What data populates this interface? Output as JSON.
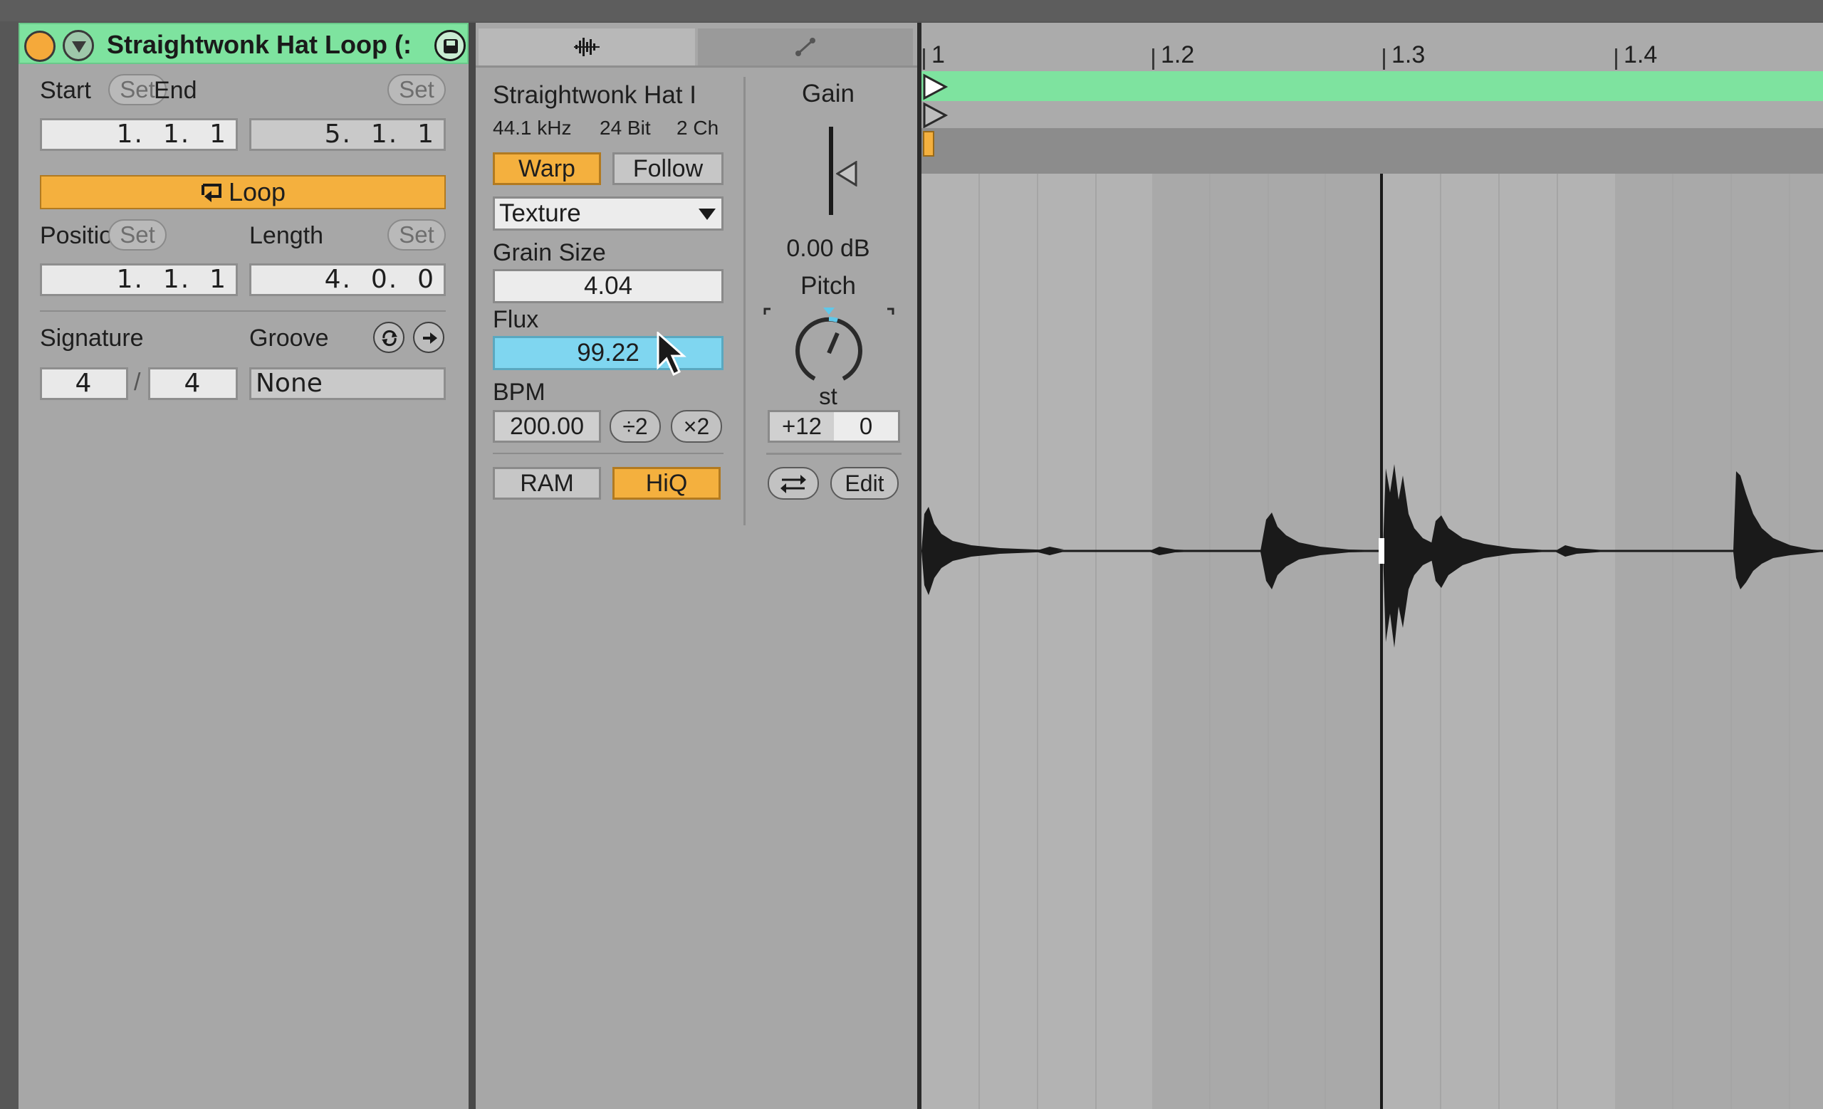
{
  "clip": {
    "name": "Straightwonk Hat Loop (:",
    "start_label": "Start",
    "end_label": "End",
    "set_label": "Set",
    "start_value": "1.  1.  1",
    "end_value": "5.  1.  1",
    "loop_label": "Loop",
    "position_label": "Position",
    "length_label": "Length",
    "position_value": "1.  1.  1",
    "length_value": "4.  0.  0",
    "signature_label": "Signature",
    "groove_label": "Groove",
    "sig_num": "4",
    "sig_slash": "/",
    "sig_den": "4",
    "groove_value": "None",
    "header_color": "#7ee39f",
    "loop_color": "#f4b03e"
  },
  "sample": {
    "file_name": "Straightwonk Hat I",
    "sample_rate": "44.1 kHz",
    "bit_depth": "24 Bit",
    "channels": "2 Ch",
    "warp_label": "Warp",
    "follow_label": "Follow",
    "warp_mode": "Texture",
    "grain_size_label": "Grain Size",
    "grain_size_value": "4.04",
    "flux_label": "Flux",
    "flux_value": "99.22",
    "bpm_label": "BPM",
    "bpm_value": "200.00",
    "half_label": "÷2",
    "double_label": "×2",
    "ram_label": "RAM",
    "hiq_label": "HiQ",
    "gain_label": "Gain",
    "gain_value": "0.00 dB",
    "pitch_label": "Pitch",
    "pitch_unit": "st",
    "transpose_range": "+12",
    "transpose_value": "0",
    "edit_label": "Edit",
    "selected_color": "#7fd6f0"
  },
  "ruler": {
    "ticks": [
      "1",
      "1.2",
      "1.3",
      "1.4"
    ]
  }
}
